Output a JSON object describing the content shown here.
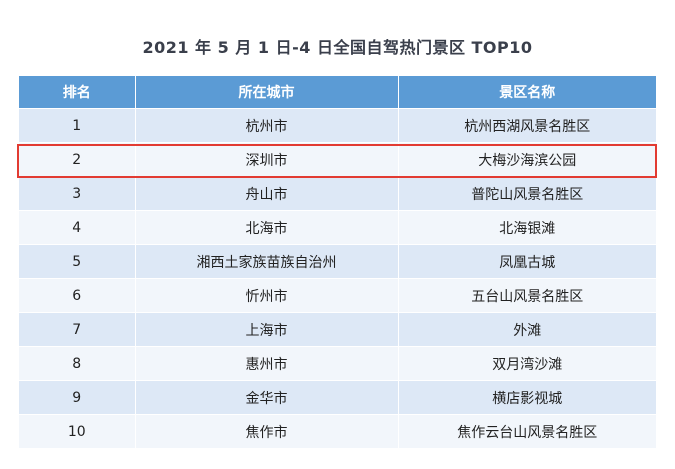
{
  "title": "2021 年 5 月 1 日-4 日全国自驾热门景区 TOP10",
  "table": {
    "headers": [
      "排名",
      "所在城市",
      "景区名称"
    ],
    "rows": [
      {
        "rank": "1",
        "city": "杭州市",
        "scenic": "杭州西湖风景名胜区"
      },
      {
        "rank": "2",
        "city": "深圳市",
        "scenic": "大梅沙海滨公园"
      },
      {
        "rank": "3",
        "city": "舟山市",
        "scenic": "普陀山风景名胜区"
      },
      {
        "rank": "4",
        "city": "北海市",
        "scenic": "北海银滩"
      },
      {
        "rank": "5",
        "city": "湘西土家族苗族自治州",
        "scenic": "凤凰古城"
      },
      {
        "rank": "6",
        "city": "忻州市",
        "scenic": "五台山风景名胜区"
      },
      {
        "rank": "7",
        "city": "上海市",
        "scenic": "外滩"
      },
      {
        "rank": "8",
        "city": "惠州市",
        "scenic": "双月湾沙滩"
      },
      {
        "rank": "9",
        "city": "金华市",
        "scenic": "横店影视城"
      },
      {
        "rank": "10",
        "city": "焦作市",
        "scenic": "焦作云台山风景名胜区"
      }
    ],
    "highlighted_row": 2
  },
  "colors": {
    "header_bg": "#5b9bd5",
    "row_odd": "#dde8f6",
    "row_even": "#f2f6fb",
    "highlight_border": "#e23b32"
  }
}
